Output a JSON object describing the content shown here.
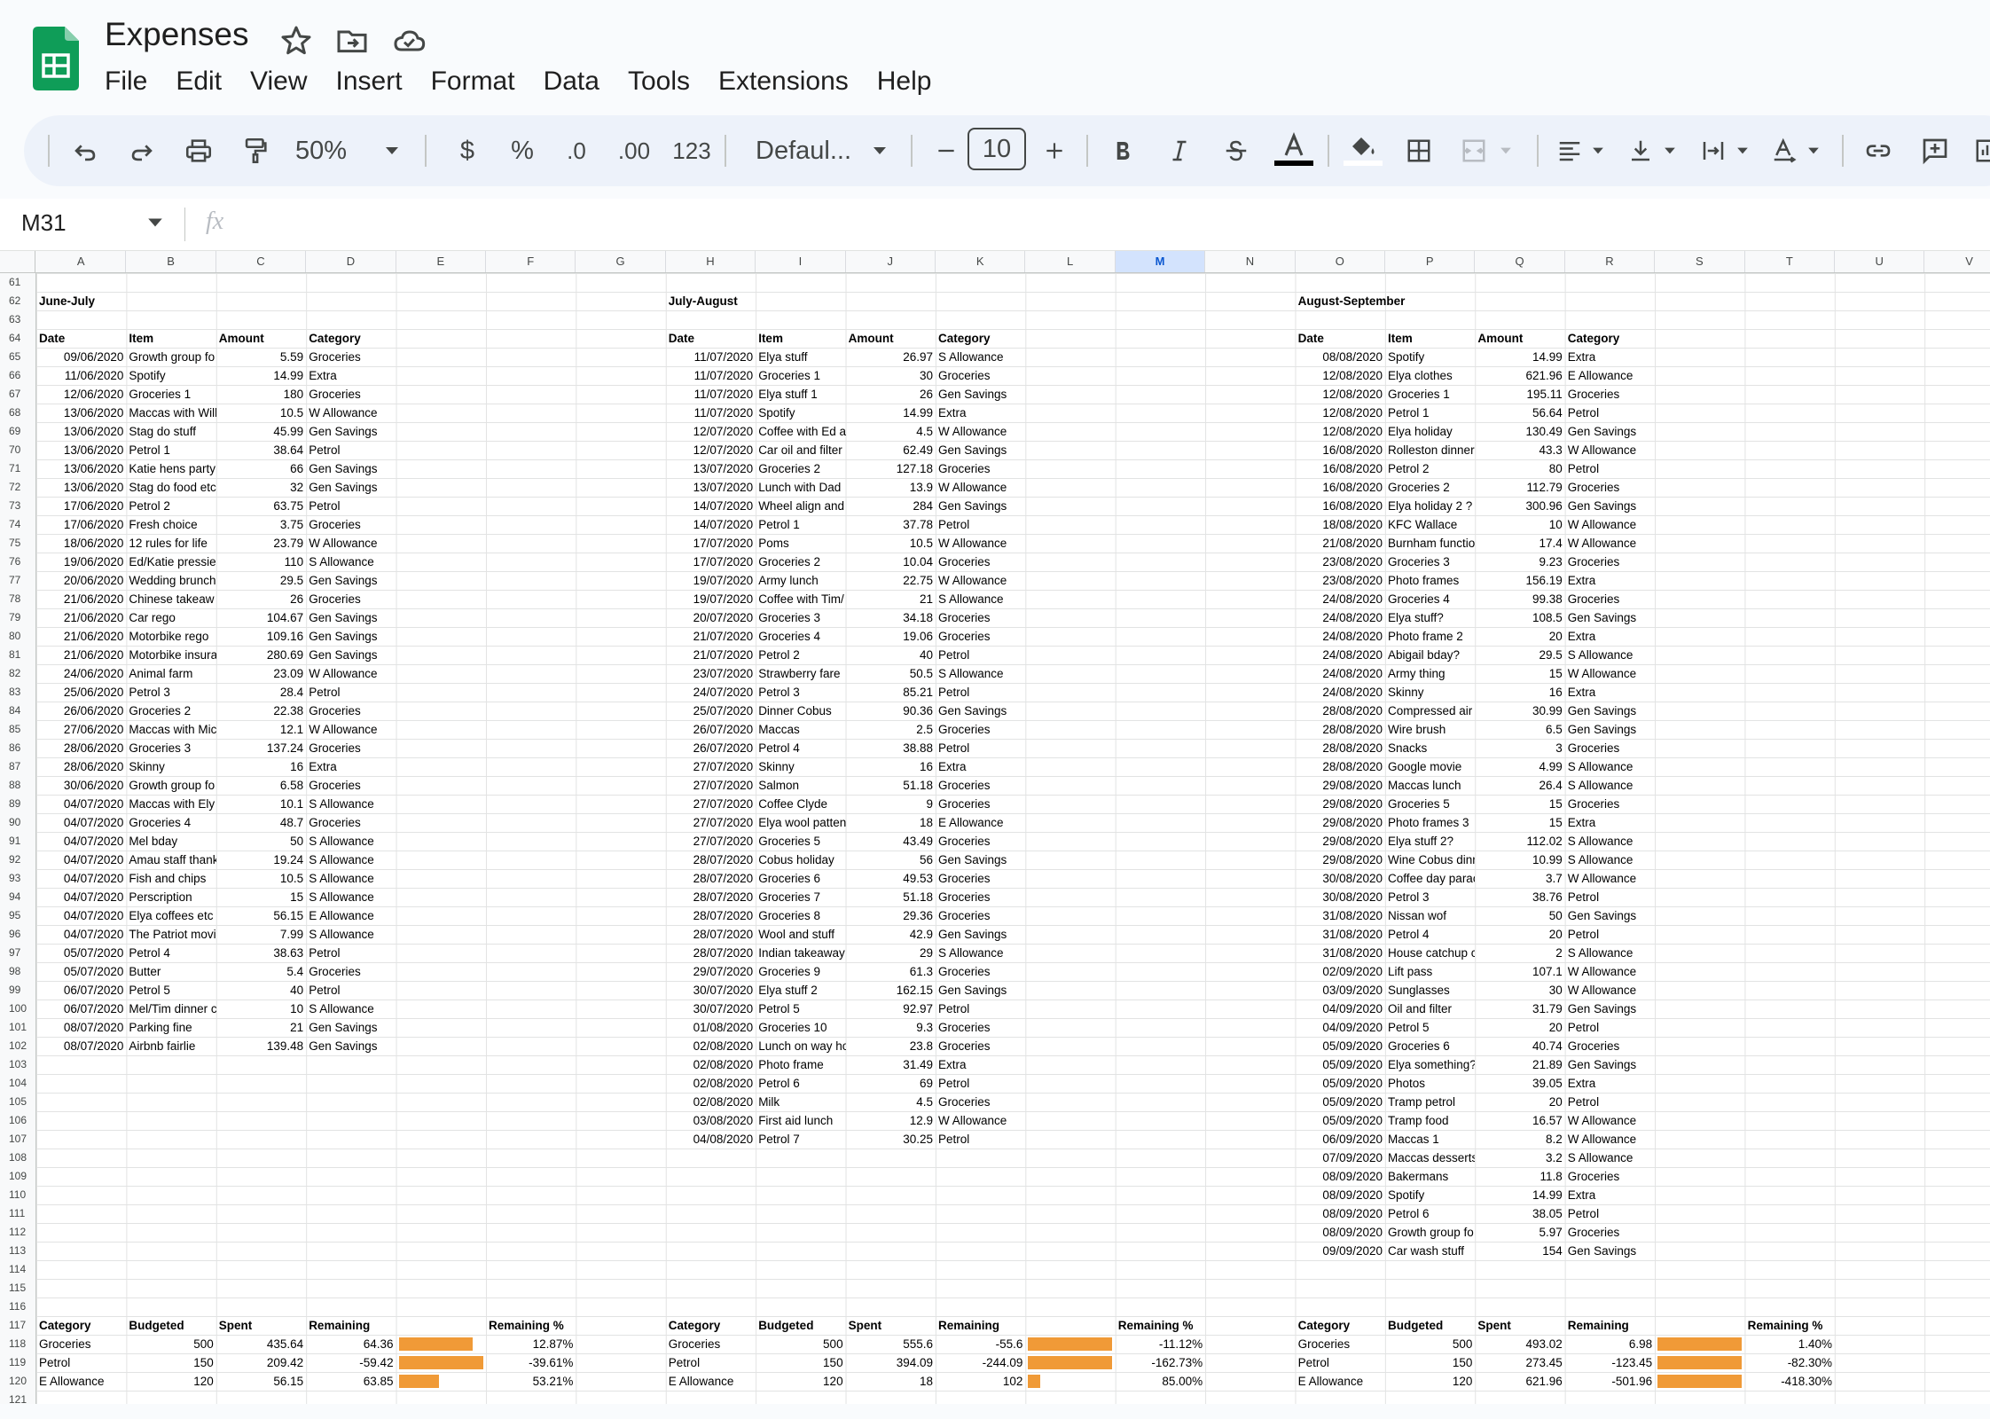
{
  "app": {
    "title": "Expenses",
    "accent": "#0f9d58"
  },
  "menu": [
    "File",
    "Edit",
    "View",
    "Insert",
    "Format",
    "Data",
    "Tools",
    "Extensions",
    "Help"
  ],
  "toolbar": {
    "zoom": "50%",
    "currency": "$",
    "percent": "%",
    "dec_decrease": ".0",
    "dec_increase": ".00",
    "number_format": "123",
    "font": "Defaul...",
    "font_size": "10",
    "icons": [
      "undo-icon",
      "redo-icon",
      "print-icon",
      "paint-format-icon",
      "bold-icon",
      "italic-icon",
      "strikethrough-icon",
      "text-color-icon",
      "fill-color-icon",
      "borders-icon",
      "merge-icon",
      "align-left-icon",
      "valign-bottom-icon",
      "text-wrap-icon",
      "text-rotate-icon",
      "link-icon",
      "comment-icon",
      "chart-icon"
    ]
  },
  "formula": {
    "cell": "M31",
    "fx": "fx"
  },
  "columns": [
    "A",
    "B",
    "C",
    "D",
    "E",
    "F",
    "G",
    "H",
    "I",
    "J",
    "K",
    "L",
    "M",
    "N",
    "O",
    "P",
    "Q",
    "R",
    "S",
    "T",
    "U",
    "V"
  ],
  "selected_column": "M",
  "rows": [
    61,
    62,
    63,
    64,
    65,
    66,
    67,
    68,
    69,
    70,
    71,
    72,
    73,
    74,
    75,
    76,
    77,
    78,
    79,
    80,
    81,
    82,
    83,
    84,
    85,
    86,
    87,
    88,
    89,
    90,
    91,
    92,
    93,
    94,
    95,
    96,
    97,
    98,
    99,
    100,
    101,
    102,
    103,
    104,
    105,
    106,
    107,
    108,
    109,
    110,
    111,
    112,
    113,
    114,
    115,
    116,
    117,
    118,
    119,
    120,
    121
  ],
  "blocks": [
    {
      "title": "June-July",
      "headers": [
        "Date",
        "Item",
        "Amount",
        "Category"
      ],
      "entries": [
        [
          "09/06/2020",
          "Growth group fo",
          "5.59",
          "Groceries"
        ],
        [
          "11/06/2020",
          "Spotify",
          "14.99",
          "Extra"
        ],
        [
          "12/06/2020",
          "Groceries 1",
          "180",
          "Groceries"
        ],
        [
          "13/06/2020",
          "Maccas with Will",
          "10.5",
          "W Allowance"
        ],
        [
          "13/06/2020",
          "Stag do stuff",
          "45.99",
          "Gen Savings"
        ],
        [
          "13/06/2020",
          "Petrol 1",
          "38.64",
          "Petrol"
        ],
        [
          "13/06/2020",
          "Katie hens party",
          "66",
          "Gen Savings"
        ],
        [
          "13/06/2020",
          "Stag do food etc",
          "32",
          "Gen Savings"
        ],
        [
          "17/06/2020",
          "Petrol 2",
          "63.75",
          "Petrol"
        ],
        [
          "17/06/2020",
          "Fresh choice",
          "3.75",
          "Groceries"
        ],
        [
          "18/06/2020",
          "12 rules for life",
          "23.79",
          "W Allowance"
        ],
        [
          "19/06/2020",
          "Ed/Katie pressie",
          "110",
          "S Allowance"
        ],
        [
          "20/06/2020",
          "Wedding brunch",
          "29.5",
          "Gen Savings"
        ],
        [
          "21/06/2020",
          "Chinese takeaw",
          "26",
          "Groceries"
        ],
        [
          "21/06/2020",
          "Car rego",
          "104.67",
          "Gen Savings"
        ],
        [
          "21/06/2020",
          "Motorbike rego",
          "109.16",
          "Gen Savings"
        ],
        [
          "21/06/2020",
          "Motorbike insura",
          "280.69",
          "Gen Savings"
        ],
        [
          "24/06/2020",
          "Animal farm",
          "23.09",
          "W Allowance"
        ],
        [
          "25/06/2020",
          "Petrol 3",
          "28.4",
          "Petrol"
        ],
        [
          "26/06/2020",
          "Groceries 2",
          "22.38",
          "Groceries"
        ],
        [
          "27/06/2020",
          "Maccas with Mic",
          "12.1",
          "W Allowance"
        ],
        [
          "28/06/2020",
          "Groceries 3",
          "137.24",
          "Groceries"
        ],
        [
          "28/06/2020",
          "Skinny",
          "16",
          "Extra"
        ],
        [
          "30/06/2020",
          "Growth group fo",
          "6.58",
          "Groceries"
        ],
        [
          "04/07/2020",
          "Maccas with Ely",
          "10.1",
          "S Allowance"
        ],
        [
          "04/07/2020",
          "Groceries 4",
          "48.7",
          "Groceries"
        ],
        [
          "04/07/2020",
          "Mel bday",
          "50",
          "S Allowance"
        ],
        [
          "04/07/2020",
          "Amau staff thank",
          "19.24",
          "S Allowance"
        ],
        [
          "04/07/2020",
          "Fish and chips",
          "10.5",
          "S Allowance"
        ],
        [
          "04/07/2020",
          "Perscription",
          "15",
          "S Allowance"
        ],
        [
          "04/07/2020",
          "Elya coffees etc",
          "56.15",
          "E Allowance"
        ],
        [
          "04/07/2020",
          "The Patriot movi",
          "7.99",
          "S Allowance"
        ],
        [
          "05/07/2020",
          "Petrol 4",
          "38.63",
          "Petrol"
        ],
        [
          "05/07/2020",
          "Butter",
          "5.4",
          "Groceries"
        ],
        [
          "06/07/2020",
          "Petrol 5",
          "40",
          "Petrol"
        ],
        [
          "06/07/2020",
          "Mel/Tim dinner c",
          "10",
          "S Allowance"
        ],
        [
          "08/07/2020",
          "Parking fine",
          "21",
          "Gen Savings"
        ],
        [
          "08/07/2020",
          "Airbnb fairlie",
          "139.48",
          "Gen Savings"
        ]
      ],
      "summary_headers": [
        "Category",
        "Budgeted",
        "Spent",
        "Remaining",
        "Remaining %"
      ],
      "summary": [
        {
          "cat": "Groceries",
          "budget": "500",
          "spent": "435.64",
          "remaining": "64.36",
          "pct": "12.87%",
          "fill": 0.87
        },
        {
          "cat": "Petrol",
          "budget": "150",
          "spent": "209.42",
          "remaining": "-59.42",
          "pct": "-39.61%",
          "fill": 1.0
        },
        {
          "cat": "E Allowance",
          "budget": "120",
          "spent": "56.15",
          "remaining": "63.85",
          "pct": "53.21%",
          "fill": 0.47
        }
      ]
    },
    {
      "title": "July-August",
      "headers": [
        "Date",
        "Item",
        "Amount",
        "Category"
      ],
      "entries": [
        [
          "11/07/2020",
          "Elya stuff",
          "26.97",
          "S Allowance"
        ],
        [
          "11/07/2020",
          "Groceries 1",
          "30",
          "Groceries"
        ],
        [
          "11/07/2020",
          "Elya stuff 1",
          "26",
          "Gen Savings"
        ],
        [
          "11/07/2020",
          "Spotify",
          "14.99",
          "Extra"
        ],
        [
          "12/07/2020",
          "Coffee with Ed a",
          "4.5",
          "W Allowance"
        ],
        [
          "12/07/2020",
          "Car oil and filter",
          "62.49",
          "Gen Savings"
        ],
        [
          "13/07/2020",
          "Groceries 2",
          "127.18",
          "Groceries"
        ],
        [
          "13/07/2020",
          "Lunch with Dad",
          "13.9",
          "W Allowance"
        ],
        [
          "14/07/2020",
          "Wheel align and",
          "284",
          "Gen Savings"
        ],
        [
          "14/07/2020",
          "Petrol 1",
          "37.78",
          "Petrol"
        ],
        [
          "17/07/2020",
          "Poms",
          "10.5",
          "W Allowance"
        ],
        [
          "17/07/2020",
          "Groceries 2",
          "10.04",
          "Groceries"
        ],
        [
          "19/07/2020",
          "Army lunch",
          "22.75",
          "W Allowance"
        ],
        [
          "19/07/2020",
          "Coffee with Tim/",
          "21",
          "S Allowance"
        ],
        [
          "20/07/2020",
          "Groceries 3",
          "34.18",
          "Groceries"
        ],
        [
          "21/07/2020",
          "Groceries 4",
          "19.06",
          "Groceries"
        ],
        [
          "21/07/2020",
          "Petrol 2",
          "40",
          "Petrol"
        ],
        [
          "23/07/2020",
          "Strawberry fare",
          "50.5",
          "S Allowance"
        ],
        [
          "24/07/2020",
          "Petrol 3",
          "85.21",
          "Petrol"
        ],
        [
          "25/07/2020",
          "Dinner Cobus",
          "90.36",
          "Gen Savings"
        ],
        [
          "26/07/2020",
          "Maccas",
          "2.5",
          "Groceries"
        ],
        [
          "26/07/2020",
          "Petrol 4",
          "38.88",
          "Petrol"
        ],
        [
          "27/07/2020",
          "Skinny",
          "16",
          "Extra"
        ],
        [
          "27/07/2020",
          "Salmon",
          "51.18",
          "Groceries"
        ],
        [
          "27/07/2020",
          "Coffee Clyde",
          "9",
          "Groceries"
        ],
        [
          "27/07/2020",
          "Elya wool patten",
          "18",
          "E Allowance"
        ],
        [
          "27/07/2020",
          "Groceries 5",
          "43.49",
          "Groceries"
        ],
        [
          "28/07/2020",
          "Cobus holiday",
          "56",
          "Gen Savings"
        ],
        [
          "28/07/2020",
          "Groceries 6",
          "49.53",
          "Groceries"
        ],
        [
          "28/07/2020",
          "Groceries 7",
          "51.18",
          "Groceries"
        ],
        [
          "28/07/2020",
          "Groceries 8",
          "29.36",
          "Groceries"
        ],
        [
          "28/07/2020",
          "Wool and stuff",
          "42.9",
          "Gen Savings"
        ],
        [
          "28/07/2020",
          "Indian takeaway",
          "29",
          "S Allowance"
        ],
        [
          "29/07/2020",
          "Groceries 9",
          "61.3",
          "Groceries"
        ],
        [
          "30/07/2020",
          "Elya stuff 2",
          "162.15",
          "Gen Savings"
        ],
        [
          "30/07/2020",
          "Petrol 5",
          "92.97",
          "Petrol"
        ],
        [
          "01/08/2020",
          "Groceries 10",
          "9.3",
          "Groceries"
        ],
        [
          "02/08/2020",
          "Lunch on way ho",
          "23.8",
          "Groceries"
        ],
        [
          "02/08/2020",
          "Photo frame",
          "31.49",
          "Extra"
        ],
        [
          "02/08/2020",
          "Petrol 6",
          "69",
          "Petrol"
        ],
        [
          "02/08/2020",
          "Milk",
          "4.5",
          "Groceries"
        ],
        [
          "03/08/2020",
          "First aid lunch",
          "12.9",
          "W Allowance"
        ],
        [
          "04/08/2020",
          "Petrol 7",
          "30.25",
          "Petrol"
        ]
      ],
      "summary_headers": [
        "Category",
        "Budgeted",
        "Spent",
        "Remaining",
        "Remaining %"
      ],
      "summary": [
        {
          "cat": "Groceries",
          "budget": "500",
          "spent": "555.6",
          "remaining": "-55.6",
          "pct": "-11.12%",
          "fill": 1.0
        },
        {
          "cat": "Petrol",
          "budget": "150",
          "spent": "394.09",
          "remaining": "-244.09",
          "pct": "-162.73%",
          "fill": 1.0
        },
        {
          "cat": "E Allowance",
          "budget": "120",
          "spent": "18",
          "remaining": "102",
          "pct": "85.00%",
          "fill": 0.15
        }
      ]
    },
    {
      "title": "August-September",
      "headers": [
        "Date",
        "Item",
        "Amount",
        "Category"
      ],
      "entries": [
        [
          "08/08/2020",
          "Spotify",
          "14.99",
          "Extra"
        ],
        [
          "12/08/2020",
          "Elya clothes",
          "621.96",
          "E Allowance"
        ],
        [
          "12/08/2020",
          "Groceries 1",
          "195.11",
          "Groceries"
        ],
        [
          "12/08/2020",
          "Petrol 1",
          "56.64",
          "Petrol"
        ],
        [
          "12/08/2020",
          "Elya holiday",
          "130.49",
          "Gen Savings"
        ],
        [
          "16/08/2020",
          "Rolleston dinner",
          "43.3",
          "W Allowance"
        ],
        [
          "16/08/2020",
          "Petrol 2",
          "80",
          "Petrol"
        ],
        [
          "16/08/2020",
          "Groceries 2",
          "112.79",
          "Groceries"
        ],
        [
          "16/08/2020",
          "Elya holiday 2 ?",
          "300.96",
          "Gen Savings"
        ],
        [
          "18/08/2020",
          "KFC Wallace",
          "10",
          "W Allowance"
        ],
        [
          "21/08/2020",
          "Burnham functio",
          "17.4",
          "W Allowance"
        ],
        [
          "23/08/2020",
          "Groceries 3",
          "9.23",
          "Groceries"
        ],
        [
          "23/08/2020",
          "Photo frames",
          "156.19",
          "Extra"
        ],
        [
          "24/08/2020",
          "Groceries 4",
          "99.38",
          "Groceries"
        ],
        [
          "24/08/2020",
          "Elya stuff?",
          "108.5",
          "Gen Savings"
        ],
        [
          "24/08/2020",
          "Photo frame 2",
          "20",
          "Extra"
        ],
        [
          "24/08/2020",
          "Abigail bday?",
          "29.5",
          "S Allowance"
        ],
        [
          "24/08/2020",
          "Army thing",
          "15",
          "W Allowance"
        ],
        [
          "24/08/2020",
          "Skinny",
          "16",
          "Extra"
        ],
        [
          "28/08/2020",
          "Compressed air",
          "30.99",
          "Gen Savings"
        ],
        [
          "28/08/2020",
          "Wire brush",
          "6.5",
          "Gen Savings"
        ],
        [
          "28/08/2020",
          "Snacks",
          "3",
          "Groceries"
        ],
        [
          "28/08/2020",
          "Google movie",
          "4.99",
          "S Allowance"
        ],
        [
          "29/08/2020",
          "Maccas lunch",
          "26.4",
          "S Allowance"
        ],
        [
          "29/08/2020",
          "Groceries 5",
          "15",
          "Groceries"
        ],
        [
          "29/08/2020",
          "Photo frames 3",
          "15",
          "Extra"
        ],
        [
          "29/08/2020",
          "Elya stuff 2?",
          "112.02",
          "S Allowance"
        ],
        [
          "29/08/2020",
          "Wine Cobus dinr",
          "10.99",
          "S Allowance"
        ],
        [
          "30/08/2020",
          "Coffee day parac",
          "3.7",
          "W Allowance"
        ],
        [
          "30/08/2020",
          "Petrol 3",
          "38.76",
          "Petrol"
        ],
        [
          "31/08/2020",
          "Nissan wof",
          "50",
          "Gen Savings"
        ],
        [
          "31/08/2020",
          "Petrol 4",
          "20",
          "Petrol"
        ],
        [
          "31/08/2020",
          "House catchup c",
          "2",
          "S Allowance"
        ],
        [
          "02/09/2020",
          "Lift pass",
          "107.1",
          "W Allowance"
        ],
        [
          "03/09/2020",
          "Sunglasses",
          "30",
          "W Allowance"
        ],
        [
          "04/09/2020",
          "Oil and filter",
          "31.79",
          "Gen Savings"
        ],
        [
          "04/09/2020",
          "Petrol 5",
          "20",
          "Petrol"
        ],
        [
          "05/09/2020",
          "Groceries 6",
          "40.74",
          "Groceries"
        ],
        [
          "05/09/2020",
          "Elya something?",
          "21.89",
          "Gen Savings"
        ],
        [
          "05/09/2020",
          "Photos",
          "39.05",
          "Extra"
        ],
        [
          "05/09/2020",
          "Tramp petrol",
          "20",
          "Petrol"
        ],
        [
          "05/09/2020",
          "Tramp food",
          "16.57",
          "W Allowance"
        ],
        [
          "06/09/2020",
          "Maccas 1",
          "8.2",
          "W Allowance"
        ],
        [
          "07/09/2020",
          "Maccas desserts",
          "3.2",
          "S Allowance"
        ],
        [
          "08/09/2020",
          "Bakermans",
          "11.8",
          "Groceries"
        ],
        [
          "08/09/2020",
          "Spotify",
          "14.99",
          "Extra"
        ],
        [
          "08/09/2020",
          "Petrol 6",
          "38.05",
          "Petrol"
        ],
        [
          "08/09/2020",
          "Growth group fo",
          "5.97",
          "Groceries"
        ],
        [
          "09/09/2020",
          "Car wash stuff",
          "154",
          "Gen Savings"
        ]
      ],
      "summary_headers": [
        "Category",
        "Budgeted",
        "Spent",
        "Remaining",
        "Remaining %"
      ],
      "summary": [
        {
          "cat": "Groceries",
          "budget": "500",
          "spent": "493.02",
          "remaining": "6.98",
          "pct": "1.40%",
          "fill": 1.0
        },
        {
          "cat": "Petrol",
          "budget": "150",
          "spent": "273.45",
          "remaining": "-123.45",
          "pct": "-82.30%",
          "fill": 1.0
        },
        {
          "cat": "E Allowance",
          "budget": "120",
          "spent": "621.96",
          "remaining": "-501.96",
          "pct": "-418.30%",
          "fill": 1.0
        }
      ]
    }
  ]
}
